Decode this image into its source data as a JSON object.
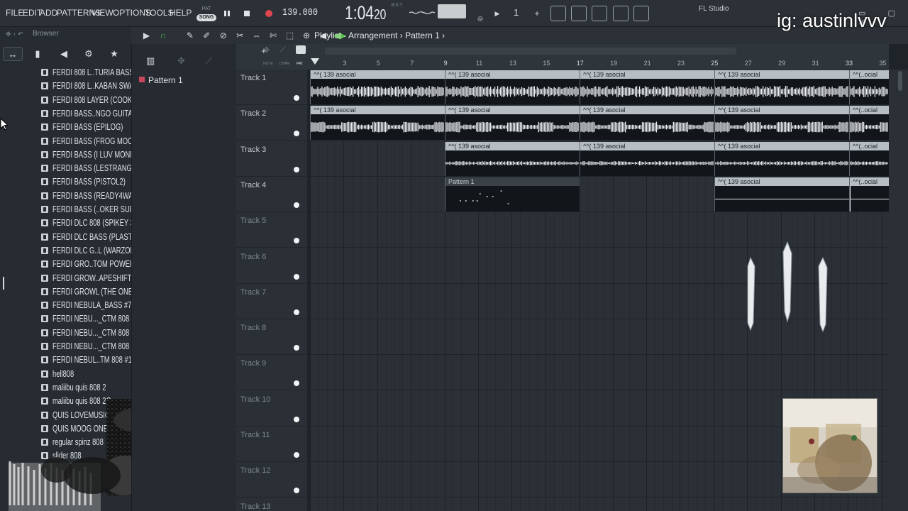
{
  "menu": {
    "items": [
      "FILE",
      "EDIT",
      "ADD",
      "PATTERNS",
      "VIEW",
      "OPTIONS",
      "TOOLS",
      "HELP"
    ]
  },
  "transport": {
    "pat_label": "PAT",
    "song_label": "SONG",
    "bpm": "139.000",
    "time_main": "1:04",
    "time_sub": "20",
    "time_unit": "B:S:T",
    "pattern_number": "1"
  },
  "app": {
    "name": "FL Studio"
  },
  "watermark": "ig: austinlvvv",
  "browser": {
    "title": "Browser",
    "files": [
      "FERDI 808 L..TURIA BASS+)",
      "FERDI 808 L..KABAN SWAG)",
      "FERDI 808 LAYER (COOK)",
      "FERDI BASS..NGO GUITAR)",
      "FERDI BASS (EPILOG)",
      "FERDI BASS (FROG MOOG)",
      "FERDI BASS (I LUV MONEY)",
      "FERDI BASS (LESTRANGE2)",
      "FERDI BASS (PISTOL2)",
      "FERDI BASS (READY4WAR)",
      "FERDI BASS (..OKER SUB 1)",
      "FERDI DLC 808 (SPIKEY 3)",
      "FERDI DLC BASS (PLASTIC)",
      "FERDI DLC G..L (WARZONE)",
      "FERDI GRO..TOM POWER)",
      "FERDI GROW..APESHIFTER)",
      "FERDI GROWL (THE ONE)",
      "FERDI NEBULA_BASS #7",
      "FERDI NEBU..._CTM 808 #3",
      "FERDI NEBU..._CTM 808 #5",
      "FERDI NEBU..._CTM 808 #7",
      "FERDI NEBUL..TM 808 #14",
      "hell808",
      "maliibu quis 808 2",
      "maliibu quis 808 2G",
      "QUIS LOVEMUSIC S...",
      "QUIS MOOG ONE SHOT",
      "regular spinz 808",
      "slider 808"
    ]
  },
  "picker": {
    "pattern": "Pattern 1",
    "labels": [
      "NOTE",
      "CHAN",
      "PAT"
    ]
  },
  "playlist": {
    "title": "Playlist - Arrangement",
    "separator": "›",
    "current_pattern": "Pattern 1",
    "bars": [
      "3",
      "5",
      "7",
      "9",
      "11",
      "13",
      "15",
      "17",
      "19",
      "21",
      "23",
      "25",
      "27",
      "29",
      "31",
      "33",
      "35"
    ],
    "tracks": [
      "Track 1",
      "Track 2",
      "Track 3",
      "Track 4",
      "Track 5",
      "Track 6",
      "Track 7",
      "Track 8",
      "Track 9",
      "Track 10",
      "Track 11",
      "Track 12",
      "Track 13"
    ],
    "clip_label": "^^( 139 asocial",
    "clip_label_short": "^^(..ocial",
    "pattern_clip_label": "Pattern 1"
  },
  "colors": {
    "bg": "#1f2428",
    "panel": "#2b3136",
    "clip_header": "#b7bec3",
    "clip_body": "#12161a",
    "pattern_swatch": "#c8475c",
    "record": "#e0464e",
    "accent_green": "#58c24a"
  }
}
